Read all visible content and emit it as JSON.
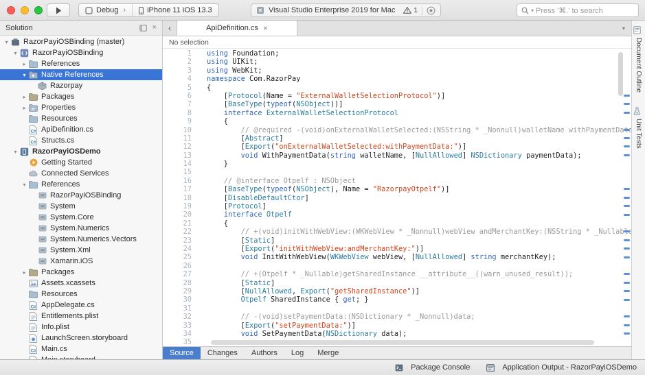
{
  "colors": {
    "selection_blue": "#3875d7",
    "subtab_active_blue": "#4a7dcb",
    "mark_blue": "#5b8fdd",
    "keyword": "#3467b4",
    "type": "#2b7c9d",
    "string": "#d0451b",
    "comment": "#9a9a9a"
  },
  "titlebar": {
    "configuration": "Debug",
    "device": "iPhone 11 iOS 13.3",
    "status_title": "Visual Studio Enterprise 2019 for Mac",
    "error_count": "1",
    "search_placeholder": "Press '⌘.' to search"
  },
  "sidebar": {
    "title": "Solution",
    "items": [
      {
        "depth": 0,
        "disclosure": "open",
        "icon": "solution-icon",
        "label": "RazorPayiOSBinding (master)"
      },
      {
        "depth": 1,
        "disclosure": "open",
        "icon": "binding-project-icon",
        "label": "RazorPayiOSBinding"
      },
      {
        "depth": 2,
        "disclosure": "closed",
        "icon": "references-folder-icon",
        "label": "References"
      },
      {
        "depth": 2,
        "disclosure": "open",
        "icon": "native-references-folder-icon",
        "label": "Native References",
        "selected": true
      },
      {
        "depth": 3,
        "icon": "native-library-icon",
        "label": "Razorpay"
      },
      {
        "depth": 2,
        "disclosure": "closed",
        "icon": "packages-folder-icon",
        "label": "Packages"
      },
      {
        "depth": 2,
        "disclosure": "closed",
        "icon": "properties-folder-icon",
        "label": "Properties"
      },
      {
        "depth": 2,
        "icon": "resources-folder-icon",
        "label": "Resources"
      },
      {
        "depth": 2,
        "icon": "cs-file-icon",
        "label": "ApiDefinition.cs"
      },
      {
        "depth": 2,
        "icon": "cs-file-icon",
        "label": "Structs.cs"
      },
      {
        "depth": 1,
        "disclosure": "open",
        "icon": "ios-project-icon",
        "label": "RazorPayiOSDemo",
        "bold": true
      },
      {
        "depth": 2,
        "icon": "getting-started-icon",
        "label": "Getting Started"
      },
      {
        "depth": 2,
        "icon": "connected-services-icon",
        "label": "Connected Services"
      },
      {
        "depth": 2,
        "disclosure": "open",
        "icon": "references-folder-icon",
        "label": "References"
      },
      {
        "depth": 3,
        "icon": "assembly-icon",
        "label": "RazorPayiOSBinding"
      },
      {
        "depth": 3,
        "icon": "assembly-icon",
        "label": "System"
      },
      {
        "depth": 3,
        "icon": "assembly-icon",
        "label": "System.Core"
      },
      {
        "depth": 3,
        "icon": "assembly-icon",
        "label": "System.Numerics"
      },
      {
        "depth": 3,
        "icon": "assembly-icon",
        "label": "System.Numerics.Vectors"
      },
      {
        "depth": 3,
        "icon": "assembly-icon",
        "label": "System.Xml"
      },
      {
        "depth": 3,
        "icon": "assembly-icon",
        "label": "Xamarin.iOS"
      },
      {
        "depth": 2,
        "disclosure": "closed",
        "icon": "packages-folder-icon",
        "label": "Packages"
      },
      {
        "depth": 2,
        "icon": "assets-icon",
        "label": "Assets.xcassets"
      },
      {
        "depth": 2,
        "icon": "resources-folder-icon",
        "label": "Resources"
      },
      {
        "depth": 2,
        "icon": "cs-file-icon",
        "label": "AppDelegate.cs"
      },
      {
        "depth": 2,
        "icon": "plist-icon",
        "label": "Entitlements.plist"
      },
      {
        "depth": 2,
        "icon": "plist-icon",
        "label": "Info.plist"
      },
      {
        "depth": 2,
        "icon": "storyboard-icon",
        "label": "LaunchScreen.storyboard"
      },
      {
        "depth": 2,
        "icon": "cs-file-icon",
        "label": "Main.cs"
      },
      {
        "depth": 2,
        "icon": "storyboard-icon",
        "label": "Main.storyboard"
      }
    ]
  },
  "editor": {
    "tab_label": "ApiDefinition.cs",
    "close_glyph": "×",
    "breadcrumb": "No selection",
    "subtabs": [
      {
        "label": "Source",
        "active": true
      },
      {
        "label": "Changes"
      },
      {
        "label": "Authors"
      },
      {
        "label": "Log"
      },
      {
        "label": "Merge"
      }
    ],
    "overview_marks": [
      6,
      7,
      8,
      10,
      11,
      12,
      13,
      17,
      18,
      19,
      20,
      22,
      23,
      24,
      25,
      27,
      28,
      29,
      30,
      32,
      33,
      34
    ]
  },
  "right_panel": {
    "tabs": [
      {
        "label": "Document Outline",
        "icon": "document-outline-icon"
      },
      {
        "label": "Unit Tests",
        "icon": "unit-tests-icon"
      }
    ]
  },
  "statusbar": {
    "items": [
      {
        "label": "Package Console",
        "icon": "package-console-icon"
      },
      {
        "label": "Application Output - RazorPayiOSDemo",
        "icon": "application-output-icon"
      }
    ]
  },
  "code": {
    "lines": [
      [
        [
          "k",
          "using"
        ],
        [
          "p",
          " Foundation;"
        ]
      ],
      [
        [
          "k",
          "using"
        ],
        [
          "p",
          " UIKit;"
        ]
      ],
      [
        [
          "k",
          "using"
        ],
        [
          "p",
          " WebKit;"
        ]
      ],
      [
        [
          "k",
          "namespace"
        ],
        [
          "p",
          " Com.RazorPay"
        ]
      ],
      [
        [
          "p",
          "{"
        ]
      ],
      [
        [
          "p",
          "    ["
        ],
        [
          "t",
          "Protocol"
        ],
        [
          "p",
          "(Name = "
        ],
        [
          "s",
          "\"ExternalWalletSelectionProtocol\""
        ],
        [
          "p",
          ")]"
        ]
      ],
      [
        [
          "p",
          "    ["
        ],
        [
          "t",
          "BaseType"
        ],
        [
          "p",
          "("
        ],
        [
          "k",
          "typeof"
        ],
        [
          "p",
          "("
        ],
        [
          "t",
          "NSObject"
        ],
        [
          "p",
          "))]"
        ]
      ],
      [
        [
          "p",
          "    "
        ],
        [
          "k",
          "interface"
        ],
        [
          "p",
          " "
        ],
        [
          "t",
          "ExternalWalletSelectionProtocol"
        ]
      ],
      [
        [
          "p",
          "    {"
        ]
      ],
      [
        [
          "c",
          "        // @required -(void)onExternalWalletSelected:(NSString * _Nonnull)walletName withPaymentData:"
        ]
      ],
      [
        [
          "p",
          "        ["
        ],
        [
          "t",
          "Abstract"
        ],
        [
          "p",
          "]"
        ]
      ],
      [
        [
          "p",
          "        ["
        ],
        [
          "t",
          "Export"
        ],
        [
          "p",
          "("
        ],
        [
          "s",
          "\"onExternalWalletSelected:withPaymentData:\""
        ],
        [
          "p",
          ")]"
        ]
      ],
      [
        [
          "p",
          "        "
        ],
        [
          "k",
          "void"
        ],
        [
          "p",
          " WithPaymentData("
        ],
        [
          "k",
          "string"
        ],
        [
          "p",
          " walletName, ["
        ],
        [
          "t",
          "NullAllowed"
        ],
        [
          "p",
          "] "
        ],
        [
          "t",
          "NSDictionary"
        ],
        [
          "p",
          " paymentData);"
        ]
      ],
      [
        [
          "p",
          "    }"
        ]
      ],
      [],
      [
        [
          "c",
          "    // @interface Otpelf : NSObject"
        ]
      ],
      [
        [
          "p",
          "    ["
        ],
        [
          "t",
          "BaseType"
        ],
        [
          "p",
          "("
        ],
        [
          "k",
          "typeof"
        ],
        [
          "p",
          "("
        ],
        [
          "t",
          "NSObject"
        ],
        [
          "p",
          "), Name = "
        ],
        [
          "s",
          "\"RazorpayOtpelf\""
        ],
        [
          "p",
          ")]"
        ]
      ],
      [
        [
          "p",
          "    ["
        ],
        [
          "t",
          "DisableDefaultCtor"
        ],
        [
          "p",
          "]"
        ]
      ],
      [
        [
          "p",
          "    ["
        ],
        [
          "t",
          "Protocol"
        ],
        [
          "p",
          "]"
        ]
      ],
      [
        [
          "p",
          "    "
        ],
        [
          "k",
          "interface"
        ],
        [
          "p",
          " "
        ],
        [
          "t",
          "Otpelf"
        ]
      ],
      [
        [
          "p",
          "    {"
        ]
      ],
      [
        [
          "c",
          "        // +(void)initWithWebView:(WKWebView * _Nonnull)webView andMerchantKey:(NSString * _Nullable)"
        ]
      ],
      [
        [
          "p",
          "        ["
        ],
        [
          "t",
          "Static"
        ],
        [
          "p",
          "]"
        ]
      ],
      [
        [
          "p",
          "        ["
        ],
        [
          "t",
          "Export"
        ],
        [
          "p",
          "("
        ],
        [
          "s",
          "\"initWithWebView:andMerchantKey:\""
        ],
        [
          "p",
          ")]"
        ]
      ],
      [
        [
          "p",
          "        "
        ],
        [
          "k",
          "void"
        ],
        [
          "p",
          " InitWithWebView("
        ],
        [
          "t",
          "WKWebView"
        ],
        [
          "p",
          " webView, ["
        ],
        [
          "t",
          "NullAllowed"
        ],
        [
          "p",
          "] "
        ],
        [
          "k",
          "string"
        ],
        [
          "p",
          " merchantKey);"
        ]
      ],
      [],
      [
        [
          "c",
          "        // +(Otpelf * _Nullable)getSharedInstance __attribute__((warn_unused_result));"
        ]
      ],
      [
        [
          "p",
          "        ["
        ],
        [
          "t",
          "Static"
        ],
        [
          "p",
          "]"
        ]
      ],
      [
        [
          "p",
          "        ["
        ],
        [
          "t",
          "NullAllowed"
        ],
        [
          "p",
          ", "
        ],
        [
          "t",
          "Export"
        ],
        [
          "p",
          "("
        ],
        [
          "s",
          "\"getSharedInstance\""
        ],
        [
          "p",
          ")]"
        ]
      ],
      [
        [
          "p",
          "        "
        ],
        [
          "t",
          "Otpelf"
        ],
        [
          "p",
          " SharedInstance { "
        ],
        [
          "k",
          "get"
        ],
        [
          "p",
          "; }"
        ]
      ],
      [],
      [
        [
          "c",
          "        // -(void)setPaymentData:(NSDictionary * _Nonnull)data;"
        ]
      ],
      [
        [
          "p",
          "        ["
        ],
        [
          "t",
          "Export"
        ],
        [
          "p",
          "("
        ],
        [
          "s",
          "\"setPaymentData:\""
        ],
        [
          "p",
          ")]"
        ]
      ],
      [
        [
          "p",
          "        "
        ],
        [
          "k",
          "void"
        ],
        [
          "p",
          " SetPaymentData("
        ],
        [
          "t",
          "NSDictionary"
        ],
        [
          "p",
          " data);"
        ]
      ],
      []
    ]
  }
}
